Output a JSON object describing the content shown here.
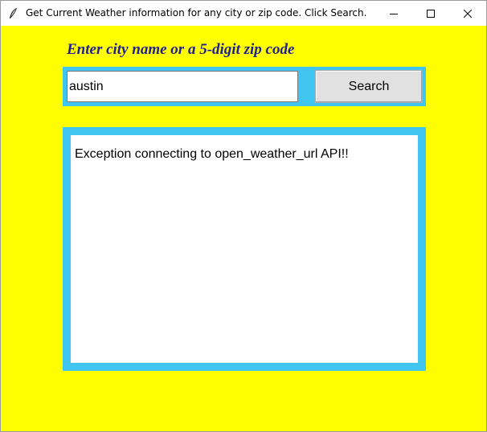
{
  "window": {
    "title": "Get Current Weather information for any city or zip code. Click Search.",
    "icon": "feather-icon",
    "controls": {
      "minimize_icon": "minimize-icon",
      "maximize_icon": "maximize-icon",
      "close_icon": "close-icon"
    }
  },
  "form": {
    "prompt": "Enter city name or a 5-digit zip code",
    "city_input_value": "austin",
    "search_label": "Search"
  },
  "output": {
    "message": "Exception connecting to open_weather_url API!!"
  },
  "colors": {
    "background": "#ffff00",
    "frame_accent": "#40c4f0",
    "prompt_text": "#1f1f8f"
  }
}
